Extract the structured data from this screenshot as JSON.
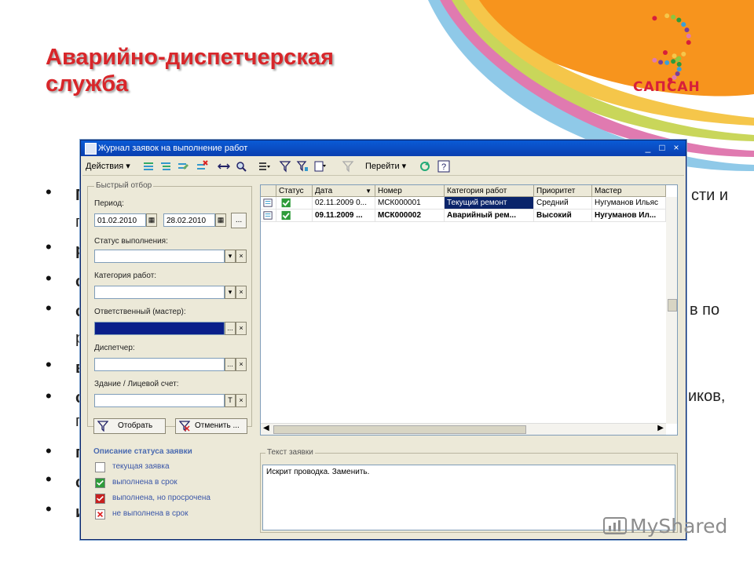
{
  "slide": {
    "title_line1": "Аварийно-диспетчерская",
    "title_line2": "служба",
    "logo_text": "САПСАН",
    "watermark": "MyShared",
    "colors": {
      "title": "#d8262a",
      "orange": "#f7941d",
      "titlebar": "#0a3fb0"
    }
  },
  "bullets": [
    {
      "frag": "П",
      "right": "сти и"
    },
    {
      "frag": "п",
      "right": ""
    },
    {
      "frag": "р",
      "right": ""
    },
    {
      "frag": "с",
      "right": ""
    },
    {
      "frag": "с",
      "right": "в по"
    },
    {
      "frag": "р",
      "right": ""
    },
    {
      "frag": "в",
      "right": ""
    },
    {
      "frag": "с",
      "right": "иков,"
    },
    {
      "frag": "п",
      "right": ""
    },
    {
      "frag": "п",
      "right": ""
    },
    {
      "frag": "с",
      "right": ""
    },
    {
      "frag": "и",
      "right": ""
    }
  ],
  "window": {
    "title": "Журнал заявок на выполнение работ",
    "controls": [
      "_",
      "□",
      "×"
    ],
    "toolbar": {
      "actions": "Действия",
      "goto": "Перейти"
    }
  },
  "filter": {
    "section_title": "Быстрый отбор",
    "period_label": "Период:",
    "date_from": "01.02.2010",
    "date_to": "28.02.2010",
    "status_label": "Статус выполнения:",
    "category_label": "Категория работ:",
    "responsible_label": "Ответственный (мастер):",
    "dispatcher_label": "Диспетчер:",
    "building_label": "Здание / Лицевой счет:",
    "apply_button": "Отобрать",
    "cancel_button": "Отменить ..."
  },
  "legend": {
    "title": "Описание статуса заявки",
    "items": [
      {
        "label": "текущая заявка",
        "color": "#ffffff",
        "icon": "empty-box-icon"
      },
      {
        "label": "выполнена в срок",
        "color": "#2e9b3a",
        "icon": "green-check-icon"
      },
      {
        "label": "выполнена, но просрочена",
        "color": "#c8201e",
        "icon": "red-check-icon"
      },
      {
        "label": "не выполнена в срок",
        "color": "#ffffff",
        "icon": "red-cross-icon"
      }
    ]
  },
  "grid": {
    "columns": [
      "Статус",
      "Дата",
      "Номер",
      "Категория работ",
      "Приоритет",
      "Мастер"
    ],
    "rows": [
      {
        "date": "02.11.2009 0...",
        "number": "МСК000001",
        "category": "Текущий ремонт",
        "priority": "Средний",
        "master": "Нугуманов Ильяс",
        "bold": false
      },
      {
        "date": "09.11.2009 ...",
        "number": "МСК000002",
        "category": "Аварийный рем...",
        "priority": "Высокий",
        "master": "Нугуманов Ил...",
        "bold": true
      }
    ]
  },
  "request_text": {
    "title": "Текст заявки",
    "value": "Искрит проводка. Заменить."
  }
}
